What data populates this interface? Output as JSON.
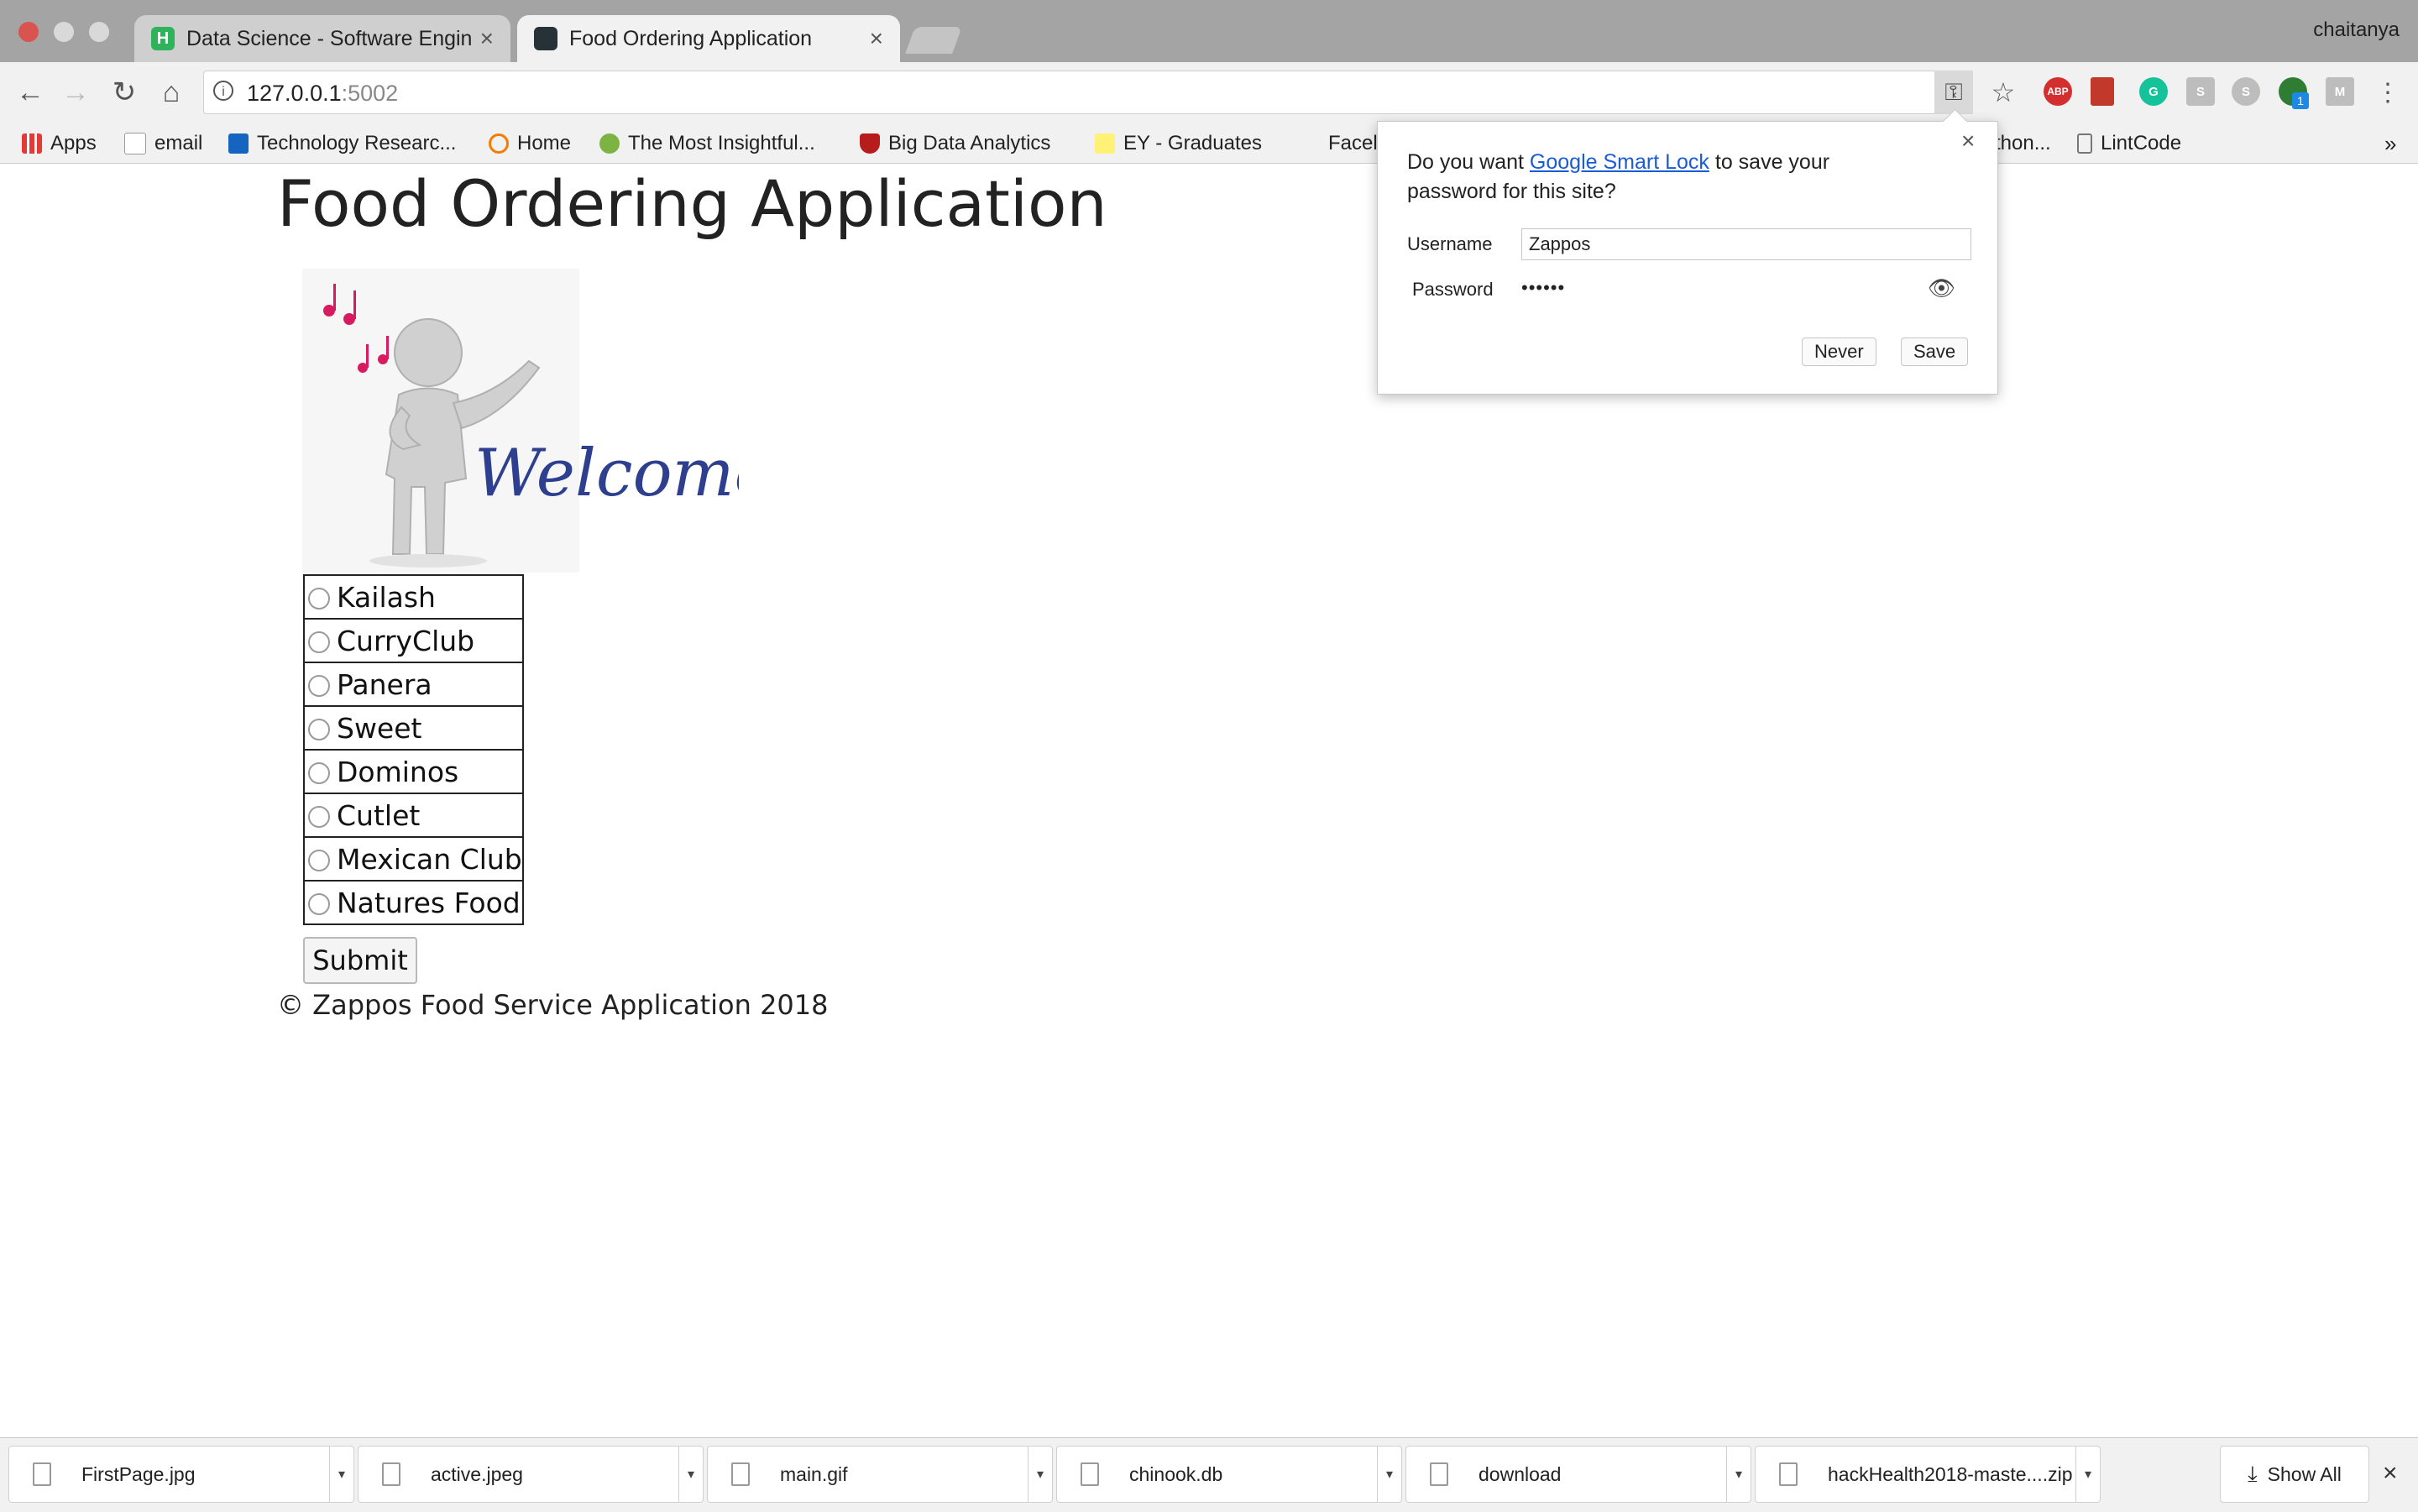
{
  "browser": {
    "tabs": [
      {
        "title": "Data Science - Software Engin",
        "favicon_color": "#2fb35a"
      },
      {
        "title": "Food Ordering Application",
        "favicon_color": "#263238"
      }
    ],
    "profile": "chaitanya",
    "url_host": "127.0.0.1",
    "url_port": ":5002",
    "bookmarks": [
      {
        "label": "Apps"
      },
      {
        "label": "email"
      },
      {
        "label": "Technology Researc..."
      },
      {
        "label": "Home"
      },
      {
        "label": "The Most Insightful..."
      },
      {
        "label": "Big Data Analytics"
      },
      {
        "label": "EY - Graduates"
      },
      {
        "label": "Facel"
      },
      {
        "label": "thon..."
      },
      {
        "label": "LintCode"
      }
    ],
    "bookmarks_more": "»",
    "extensions": [
      "ABP",
      "G",
      "S",
      "S",
      "1",
      "M"
    ]
  },
  "page": {
    "title": "Food Ordering Application",
    "welcome_text": "Welcome",
    "restaurants": [
      "Kailash",
      "CurryClub",
      "Panera",
      "Sweet",
      "Dominos",
      "Cutlet",
      "Mexican Club",
      "Natures Food"
    ],
    "submit_label": "Submit",
    "footer": "© Zappos Food Service Application 2018"
  },
  "password_popup": {
    "question_prefix": "Do you want ",
    "link_text": "Google Smart Lock",
    "question_suffix": " to save your password for this site?",
    "username_label": "Username",
    "username_value": "Zappos",
    "password_label": "Password",
    "password_value": "••••••",
    "never_label": "Never",
    "save_label": "Save",
    "close": "×"
  },
  "downloads": {
    "items": [
      "FirstPage.jpg",
      "active.jpeg",
      "main.gif",
      "chinook.db",
      "download",
      "hackHealth2018-maste....zip"
    ],
    "show_all": "Show All",
    "close": "×"
  }
}
